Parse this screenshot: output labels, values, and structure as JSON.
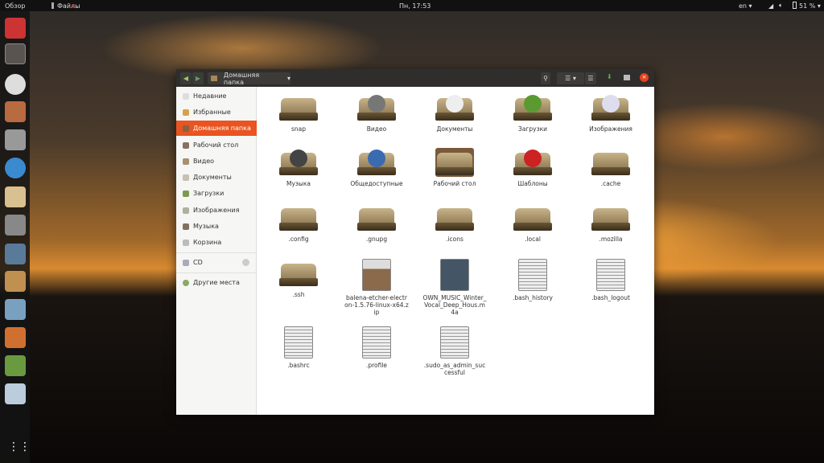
{
  "topbar": {
    "activities": "Обзор",
    "app": "Файлы",
    "clock": "Пн, 17:53",
    "lang": "en ▾",
    "battery": "51 % ▾"
  },
  "window": {
    "location": "Домашняя папка"
  },
  "sidebar": {
    "items": [
      {
        "label": "Недавние"
      },
      {
        "label": "Избранные"
      },
      {
        "label": "Домашняя папка"
      },
      {
        "label": "Рабочий стол"
      },
      {
        "label": "Видео"
      },
      {
        "label": "Документы"
      },
      {
        "label": "Загрузки"
      },
      {
        "label": "Изображения"
      },
      {
        "label": "Музыка"
      },
      {
        "label": "Корзина"
      }
    ],
    "devices": [
      {
        "label": "CD"
      }
    ],
    "other": "Другие места"
  },
  "files": [
    {
      "name": "snap",
      "kind": "folder"
    },
    {
      "name": "Видео",
      "kind": "folder",
      "badge": "film-reel"
    },
    {
      "name": "Документы",
      "kind": "folder",
      "badge": "document"
    },
    {
      "name": "Загрузки",
      "kind": "folder",
      "badge": "download"
    },
    {
      "name": "Изображения",
      "kind": "folder",
      "badge": "picture"
    },
    {
      "name": "Музыка",
      "kind": "folder",
      "badge": "music"
    },
    {
      "name": "Общедоступные",
      "kind": "folder",
      "badge": "globe"
    },
    {
      "name": "Рабочий стол",
      "kind": "desk"
    },
    {
      "name": "Шаблоны",
      "kind": "folder",
      "badge": "gift"
    },
    {
      "name": ".cache",
      "kind": "folder"
    },
    {
      "name": ".config",
      "kind": "folder"
    },
    {
      "name": ".gnupg",
      "kind": "folder"
    },
    {
      "name": ".icons",
      "kind": "folder"
    },
    {
      "name": ".local",
      "kind": "folder"
    },
    {
      "name": ".mozilla",
      "kind": "folder"
    },
    {
      "name": ".ssh",
      "kind": "folder"
    },
    {
      "name": "balena-etcher-electron-1.5.76-linux-x64.zip",
      "kind": "archive"
    },
    {
      "name": "OWN_MUSIC_Winter_Vocal_Deep_Hous.m4a",
      "kind": "audio"
    },
    {
      "name": ".bash_history",
      "kind": "text"
    },
    {
      "name": ".bash_logout",
      "kind": "text"
    },
    {
      "name": ".bashrc",
      "kind": "text"
    },
    {
      "name": ".profile",
      "kind": "text"
    },
    {
      "name": ".sudo_as_admin_successful",
      "kind": "text"
    }
  ],
  "colors": {
    "accent": "#e95420",
    "header": "#2f2e2c"
  }
}
